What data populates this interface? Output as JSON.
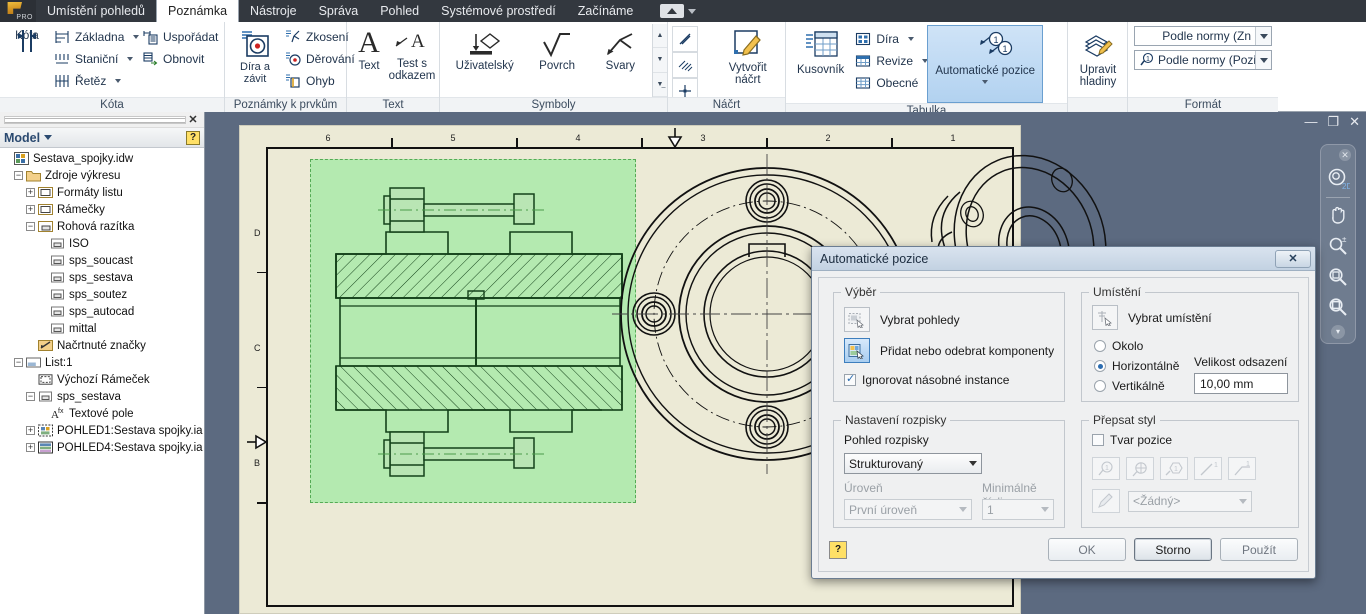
{
  "app": {
    "logo_text": "PRO"
  },
  "menubar": {
    "items": [
      {
        "label": "Umístění pohledů",
        "active": false
      },
      {
        "label": "Poznámka",
        "active": true
      },
      {
        "label": "Nástroje",
        "active": false
      },
      {
        "label": "Správa",
        "active": false
      },
      {
        "label": "Pohled",
        "active": false
      },
      {
        "label": "Systémové prostředí",
        "active": false
      },
      {
        "label": "Začínáme",
        "active": false
      }
    ]
  },
  "ribbon": {
    "groups": [
      {
        "title": "Kóta",
        "big": {
          "label": "Kóta",
          "icon": "dimension-icon"
        },
        "small": [
          {
            "label": "Základna",
            "icon": "baseline-dimension-icon",
            "dropdown": true
          },
          {
            "label": "Staniční",
            "icon": "ordinate-dimension-icon",
            "dropdown": true
          },
          {
            "label": "Řetěz",
            "icon": "chain-dimension-icon",
            "dropdown": true
          }
        ],
        "small2": [
          {
            "label": "Uspořádat",
            "icon": "arrange-icon",
            "dropdown": false
          },
          {
            "label": "Obnovit",
            "icon": "refresh-icon",
            "dropdown": false
          }
        ]
      },
      {
        "title": "Poznámky k prvkům",
        "big": {
          "label": "Díra a závit",
          "icon": "hole-thread-icon"
        },
        "small": [
          {
            "label": "Zkosení",
            "icon": "chamfer-icon",
            "dropdown": false
          },
          {
            "label": "Děrování",
            "icon": "punch-icon",
            "dropdown": false
          },
          {
            "label": "Ohyb",
            "icon": "bend-icon",
            "dropdown": false
          }
        ]
      },
      {
        "title": "Text",
        "buttons": [
          {
            "label": "Text",
            "icon": "text-icon"
          },
          {
            "label": "Test s odkazem",
            "icon": "leader-text-icon"
          }
        ]
      },
      {
        "title": "Symboly",
        "buttons": [
          {
            "label": "Uživatelský",
            "icon": "custom-symbol-icon"
          },
          {
            "label": "Povrch",
            "icon": "surface-finish-icon"
          },
          {
            "label": "Svary",
            "icon": "weld-symbol-icon"
          }
        ]
      },
      {
        "title": "Náčrt",
        "tools": [
          "line-tool-icon",
          "hatch-tool-icon",
          "point-tool-icon",
          "sketch-points-icon"
        ],
        "big": {
          "label": "Vytvořit náčrt",
          "icon": "create-sketch-icon"
        }
      },
      {
        "title": "Tabulka",
        "big": {
          "label": "Kusovník",
          "icon": "parts-list-icon"
        },
        "small": [
          {
            "label": "Díra",
            "icon": "hole-table-icon",
            "dropdown": true
          },
          {
            "label": "Revize",
            "icon": "revision-table-icon",
            "dropdown": true
          },
          {
            "label": "Obecné",
            "icon": "general-table-icon",
            "dropdown": false
          }
        ],
        "big2": {
          "label": "Automatické pozice",
          "icon": "auto-balloon-icon",
          "active": true,
          "dropdown": true
        },
        "big3": {
          "label": "Upravit hladiny",
          "icon": "edit-layers-icon"
        }
      },
      {
        "title": "Formát",
        "combos": [
          {
            "value": "Podle normy (Zn",
            "icon": null
          },
          {
            "value": "Podle normy (Pozice",
            "icon": "balloon-style-icon"
          }
        ]
      }
    ]
  },
  "browser": {
    "header_title": "Model",
    "help_glyph": "?",
    "close_glyph": "✕",
    "tree": [
      {
        "depth": 0,
        "toggle": "none",
        "icon": "drawing-file-icon",
        "label": "Sestava_spojky.idw"
      },
      {
        "depth": 1,
        "toggle": "minus",
        "icon": "folder-icon",
        "label": "Zdroje výkresu"
      },
      {
        "depth": 2,
        "toggle": "plus",
        "icon": "sheet-format-icon",
        "label": "Formáty listu"
      },
      {
        "depth": 2,
        "toggle": "plus",
        "icon": "border-icon",
        "label": "Rámečky"
      },
      {
        "depth": 2,
        "toggle": "minus",
        "icon": "titleblock-icon",
        "label": "Rohová razítka"
      },
      {
        "depth": 3,
        "toggle": "none",
        "icon": "titleblock-item-icon",
        "label": "ISO"
      },
      {
        "depth": 3,
        "toggle": "none",
        "icon": "titleblock-item-icon",
        "label": "sps_soucast"
      },
      {
        "depth": 3,
        "toggle": "none",
        "icon": "titleblock-item-icon",
        "label": "sps_sestava"
      },
      {
        "depth": 3,
        "toggle": "none",
        "icon": "titleblock-item-icon",
        "label": "sps_soutez"
      },
      {
        "depth": 3,
        "toggle": "none",
        "icon": "titleblock-item-icon",
        "label": "sps_autocad"
      },
      {
        "depth": 3,
        "toggle": "none",
        "icon": "titleblock-item-icon",
        "label": "mittal"
      },
      {
        "depth": 2,
        "toggle": "none",
        "icon": "sketched-symbol-icon",
        "label": "Načrtnuté značky"
      },
      {
        "depth": 1,
        "toggle": "minus",
        "icon": "sheet-icon",
        "label": "List:1"
      },
      {
        "depth": 2,
        "toggle": "none",
        "icon": "default-border-icon",
        "label": "Výchozí Rámeček"
      },
      {
        "depth": 2,
        "toggle": "minus",
        "icon": "titleblock-item-icon",
        "label": "sps_sestava"
      },
      {
        "depth": 3,
        "toggle": "none",
        "icon": "text-field-icon",
        "label": "Textové pole"
      },
      {
        "depth": 2,
        "toggle": "plus",
        "icon": "view-icon",
        "label": "POHLED1:Sestava spojky.ia"
      },
      {
        "depth": 2,
        "toggle": "plus",
        "icon": "view-section-icon",
        "label": "POHLED4:Sestava spojky.ia"
      }
    ]
  },
  "canvas": {
    "window_buttons": [
      "minimize-button",
      "restore-button",
      "close-button"
    ],
    "window_glyphs": {
      "minimize": "—",
      "restore": "❐",
      "close": "✕"
    },
    "zone_labels_top": [
      "6",
      "5",
      "4",
      "3",
      "2",
      "1"
    ],
    "zone_labels_left": [
      "D",
      "C",
      "B"
    ],
    "navbar": {
      "close_glyph": "✕",
      "tools": [
        "steeringwheel-2d-icon",
        "pan-icon",
        "zoom-icon",
        "zoom-window-icon",
        "zoom-all-icon"
      ],
      "more_glyph": "▾"
    },
    "paper_color": "#ecead6",
    "highlight_color": "#b4eab0",
    "highlight_border_color": "#55aa55"
  },
  "dialog": {
    "title": "Automatické pozice",
    "close_glyph": "✕",
    "selection": {
      "legend": "Výběr",
      "select_views": {
        "label": "Vybrat pohledy",
        "icon": "select-views-icon",
        "active": false
      },
      "add_remove": {
        "label": "Přidat nebo odebrat komponenty",
        "icon": "add-remove-components-icon",
        "active": true
      },
      "ignore_multiple": {
        "label": "Ignorovat násobné instance",
        "checked": true
      }
    },
    "placement": {
      "legend": "Umístění",
      "select_placement": {
        "label": "Vybrat umístění",
        "icon": "select-placement-icon"
      },
      "options": [
        {
          "label": "Okolo",
          "selected": false
        },
        {
          "label": "Horizontálně",
          "selected": true
        },
        {
          "label": "Vertikálně",
          "selected": false
        }
      ],
      "offset_label": "Velikost odsazení",
      "offset_value": "10,00 mm"
    },
    "bom": {
      "legend": "Nastavení rozpisky",
      "view_label": "Pohled rozpisky",
      "view_value": "Strukturovaný",
      "level_label": "Úroveň",
      "level_value": "První úroveň",
      "level_disabled": true,
      "mindigits_label": "Minimálně číslic",
      "mindigits_value": "1",
      "mindigits_disabled": true
    },
    "override": {
      "legend": "Přepsat styl",
      "shape_label": "Tvar pozice",
      "shape_checked": false,
      "shape_buttons": [
        "balloon-circle-icon",
        "balloon-circle-split-icon",
        "balloon-hexagon-icon",
        "balloon-none-icon",
        "balloon-underline-icon"
      ],
      "style_brush_icon": "brush-icon",
      "style_value": "<Žádný>",
      "style_disabled": true
    },
    "footer": {
      "help_glyph": "?",
      "buttons": [
        {
          "label": "OK",
          "enabled": false
        },
        {
          "label": "Storno",
          "enabled": true
        },
        {
          "label": "Použít",
          "enabled": false
        }
      ]
    }
  }
}
